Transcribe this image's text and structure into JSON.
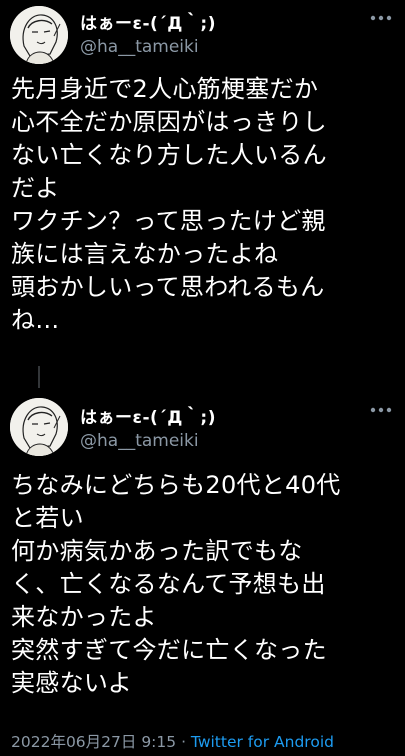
{
  "tweets": [
    {
      "display_name": "はぁーε-(´Д｀;)",
      "handle": "@ha__tameiki",
      "more_icon": "more-horizontal-icon",
      "text": "先月身近で2人心筋梗塞だか\n心不全だか原因がはっきりし\nない亡くなり方した人いるん\nだよ\nワクチン？って思ったけど親\n族には言えなかったよね\n頭おかしいって思われるもん\nね…"
    },
    {
      "display_name": "はぁーε-(´Д｀;)",
      "handle": "@ha__tameiki",
      "more_icon": "more-horizontal-icon",
      "text": "ちなみにどちらも20代と40代\nと若い\n何か病気かあった訳でもな\nく、亡くなるなんて予想も出\n来なかったよ\n突然すぎて今だに亡くなった\n実感ないよ"
    }
  ],
  "meta": {
    "datetime": "2022年06月27日 9:15",
    "separator": " · ",
    "source_app": "Twitter for Android"
  },
  "colors": {
    "background": "#000000",
    "text": "#ffffff",
    "secondary": "#8b98a5",
    "link": "#1d9bf0"
  }
}
